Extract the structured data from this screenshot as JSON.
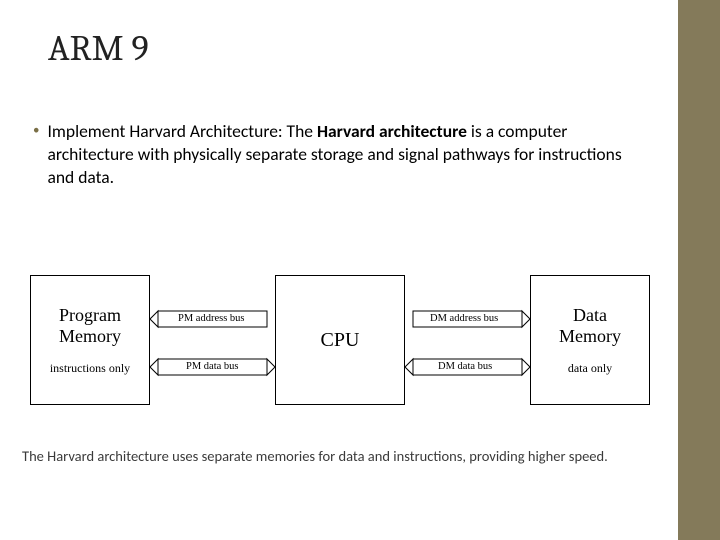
{
  "title": "ARM 9",
  "bullet": {
    "prefix": "Implement Harvard Architecture: The ",
    "bold": "Harvard architecture",
    "rest": " is a computer architecture with physically separate storage and signal pathways for instructions and data."
  },
  "diagram": {
    "program_memory": {
      "title": "Program\nMemory",
      "sub": "instructions only"
    },
    "cpu": "CPU",
    "data_memory": {
      "title": "Data\nMemory",
      "sub": "data only"
    },
    "buses": {
      "pm_addr": "PM address bus",
      "pm_data": "PM data bus",
      "dm_addr": "DM address bus",
      "dm_data": "DM data bus"
    }
  },
  "caption": "The Harvard architecture uses separate memories for data and instructions, providing higher speed."
}
